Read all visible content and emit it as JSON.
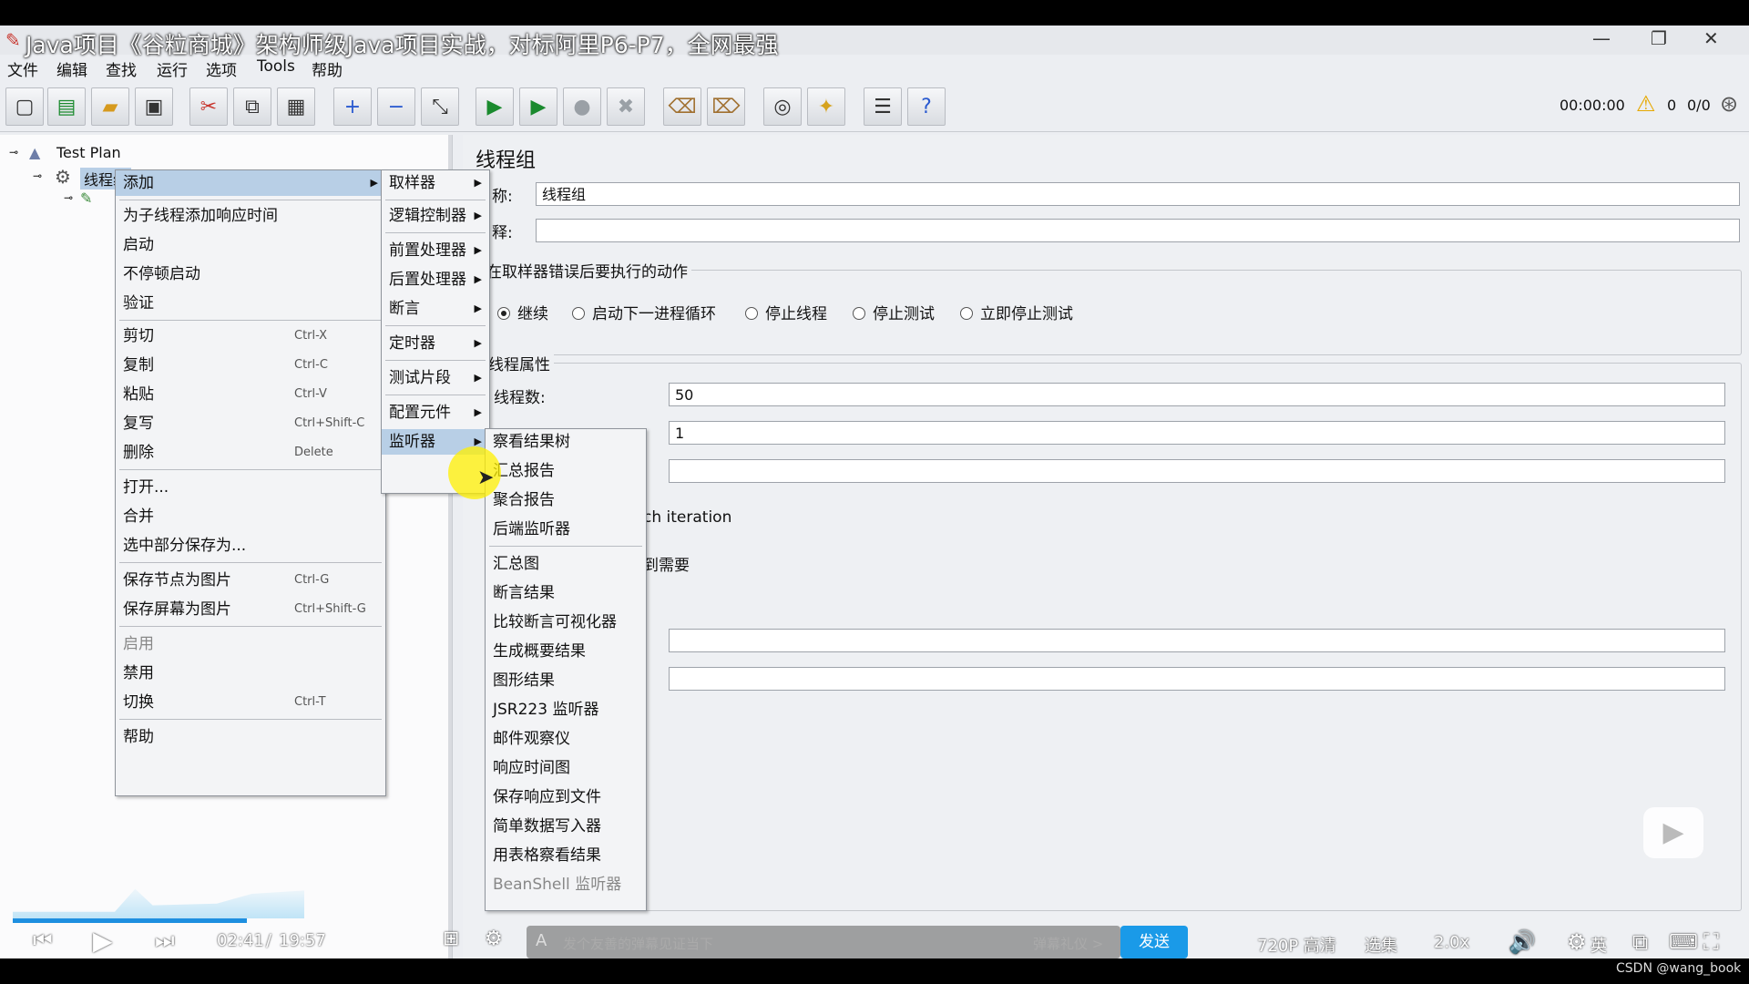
{
  "window": {
    "title": "Java项目《谷粒商城》架构师级Java项目实战，对标阿里P6-P7，全网最强"
  },
  "menubar": [
    "文件",
    "编辑",
    "查找",
    "运行",
    "选项",
    "Tools",
    "帮助"
  ],
  "toolbar": {
    "timer": "00:00:00",
    "warn_count": "0",
    "thread_ratio": "0/0"
  },
  "tree": {
    "root": "Test Plan",
    "child": "线程组"
  },
  "right": {
    "title": "线程组",
    "name_label": "称:",
    "name_value": "线程组",
    "comment_label": "释:",
    "error_section": "在取样器错误后要执行的动作",
    "radios": [
      "继续",
      "启动下一进程循环",
      "停止线程",
      "停止测试",
      "立即停止测试"
    ],
    "thread_props": "线程属性",
    "threads_label": "线程数:",
    "threads_value": "50",
    "rampup_value": "1",
    "iteration_text": "ch iteration",
    "need_text": "到需要"
  },
  "context_menu": {
    "add": "添加",
    "items": [
      {
        "label": "为子线程添加响应时间",
        "shortcut": ""
      },
      {
        "label": "启动",
        "shortcut": ""
      },
      {
        "label": "不停顿启动",
        "shortcut": ""
      },
      {
        "label": "验证",
        "shortcut": ""
      },
      {
        "label": "剪切",
        "shortcut": "Ctrl-X"
      },
      {
        "label": "复制",
        "shortcut": "Ctrl-C"
      },
      {
        "label": "粘贴",
        "shortcut": "Ctrl-V"
      },
      {
        "label": "复写",
        "shortcut": "Ctrl+Shift-C"
      },
      {
        "label": "删除",
        "shortcut": "Delete"
      },
      {
        "label": "打开...",
        "shortcut": ""
      },
      {
        "label": "合并",
        "shortcut": ""
      },
      {
        "label": "选中部分保存为...",
        "shortcut": ""
      },
      {
        "label": "保存节点为图片",
        "shortcut": "Ctrl-G"
      },
      {
        "label": "保存屏幕为图片",
        "shortcut": "Ctrl+Shift-G"
      },
      {
        "label": "启用",
        "shortcut": ""
      },
      {
        "label": "禁用",
        "shortcut": ""
      },
      {
        "label": "切换",
        "shortcut": "Ctrl-T"
      },
      {
        "label": "帮助",
        "shortcut": ""
      }
    ]
  },
  "submenu_add": [
    "取样器",
    "逻辑控制器",
    "前置处理器",
    "后置处理器",
    "断言",
    "定时器",
    "测试片段",
    "配置元件",
    "监听器"
  ],
  "submenu_listeners": [
    "察看结果树",
    "汇总报告",
    "聚合报告",
    "后端监听器",
    "汇总图",
    "断言结果",
    "比较断言可视化器",
    "生成概要结果",
    "图形结果",
    "JSR223 监听器",
    "邮件观察仪",
    "响应时间图",
    "保存响应到文件",
    "简单数据写入器",
    "用表格察看结果",
    "BeanShell 监听器"
  ],
  "player": {
    "time": "02:41",
    "sep": "/",
    "duration": "19:57",
    "progress_fraction": 0.136,
    "danmu_placeholder": "发个友善的弹幕见证当下",
    "gift": "弹幕礼仪 >",
    "send": "发送",
    "quality": "720P 高清",
    "episodes": "选集",
    "speed": "2.0x",
    "ime": "英",
    "watermark": "CSDN @wang_book"
  }
}
